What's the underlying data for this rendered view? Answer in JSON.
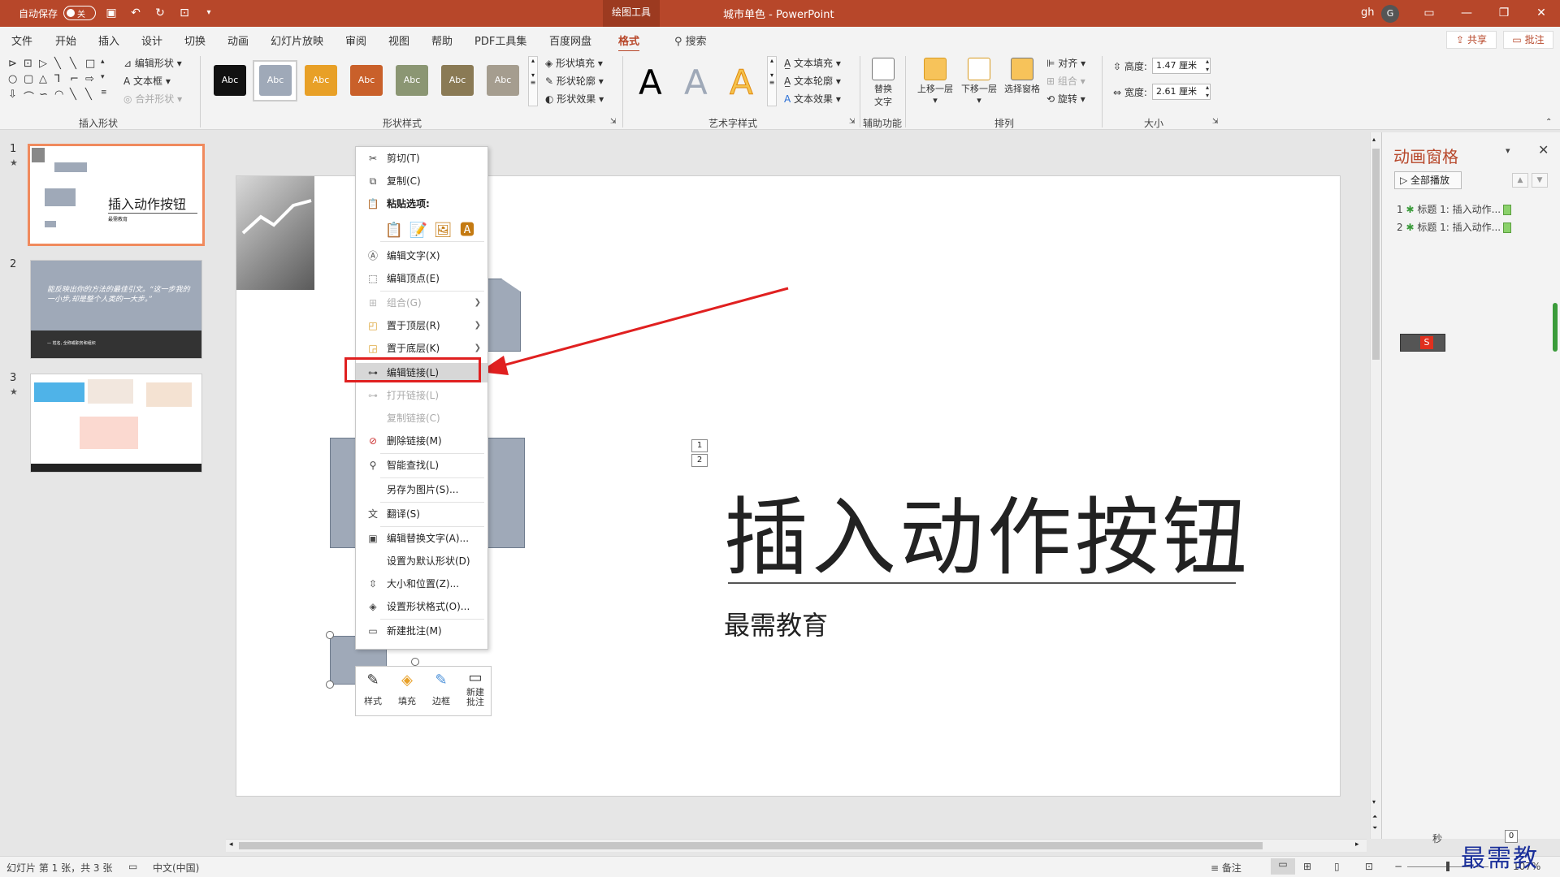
{
  "titlebar": {
    "autosave_label": "自动保存",
    "autosave_state": "关",
    "context_tab": "绘图工具",
    "doc_name": "城市单色",
    "app_name": "PowerPoint",
    "user_name": "gh",
    "user_initial": "G",
    "accent_color": "#b7472a"
  },
  "menu": {
    "tabs": [
      "文件",
      "开始",
      "插入",
      "设计",
      "切换",
      "动画",
      "幻灯片放映",
      "审阅",
      "视图",
      "帮助",
      "PDF工具集",
      "百度网盘",
      "格式"
    ],
    "active_tab": "格式",
    "search_placeholder": "搜索",
    "share_label": "共享",
    "comment_label": "批注"
  },
  "ribbon": {
    "insert_shapes": {
      "label": "插入形状",
      "edit_shape": "编辑形状",
      "text_box": "文本框",
      "merge_shapes": "合并形状"
    },
    "shape_styles": {
      "label": "形状样式",
      "swatch_text": "Abc",
      "swatches": [
        "#111111",
        "#9fa9b8",
        "#e8a027",
        "#c9602a",
        "#8b9673",
        "#8a7a55",
        "#a59d8f"
      ],
      "fill": "形状填充",
      "outline": "形状轮廓",
      "effects": "形状效果"
    },
    "wordart": {
      "label": "艺术字样式",
      "glyph": "A",
      "text_fill": "文本填充",
      "text_outline": "文本轮廓",
      "text_effects": "文本效果"
    },
    "accessibility": {
      "label": "辅助功能",
      "alt_text_line1": "替换",
      "alt_text_line2": "文字"
    },
    "arrange": {
      "label": "排列",
      "bring_forward": "上移一层",
      "send_backward": "下移一层",
      "selection_pane": "选择窗格",
      "align": "对齐",
      "group": "组合",
      "rotate": "旋转"
    },
    "size": {
      "label": "大小",
      "height_label": "高度:",
      "height_value": "1.47 厘米",
      "width_label": "宽度:",
      "width_value": "2.61 厘米"
    }
  },
  "thumbnails": {
    "slides": [
      {
        "num": "1",
        "title": "插入动作按钮",
        "subtitle": "最需教育"
      },
      {
        "num": "2",
        "quote": "能反映出你的方法的最佳引文。“这一步我的一小步,却是整个人类的一大步。”",
        "caption": "— 姓名, 全称或职务和组织"
      },
      {
        "num": "3"
      }
    ]
  },
  "slide": {
    "title": "插入动作按钮",
    "subtitle": "最需教育",
    "anim_tags": [
      "1",
      "2"
    ]
  },
  "context_menu": {
    "cut": "剪切(T)",
    "copy": "复制(C)",
    "paste_options": "粘贴选项:",
    "edit_text": "编辑文字(X)",
    "edit_points": "编辑顶点(E)",
    "group": "组合(G)",
    "bring_to_front": "置于顶层(R)",
    "send_to_back": "置于底层(K)",
    "edit_link": "编辑链接(L)",
    "open_link": "打开链接(L)",
    "copy_link": "复制链接(C)",
    "remove_link": "删除链接(M)",
    "smart_lookup": "智能查找(L)",
    "save_as_picture": "另存为图片(S)...",
    "translate": "翻译(S)",
    "edit_alt_text": "编辑替换文字(A)...",
    "set_default_shape": "设置为默认形状(D)",
    "size_position": "大小和位置(Z)...",
    "format_shape": "设置形状格式(O)...",
    "new_comment": "新建批注(M)"
  },
  "mini_toolbar": {
    "style": "样式",
    "fill": "填充",
    "outline": "边框",
    "new_comment_1": "新建",
    "new_comment_2": "批注"
  },
  "anim_pane": {
    "title": "动画窗格",
    "play_all": "全部播放",
    "items": [
      {
        "num": "1",
        "text": "标题 1: 插入动作..."
      },
      {
        "num": "2",
        "text": "标题 1: 插入动作..."
      }
    ]
  },
  "status": {
    "slide_info": "幻灯片 第 1 张，共 3 张",
    "language": "中文(中国)",
    "notes": "备注",
    "seconds": "秒",
    "zoom_box": "0",
    "zoom": "107%"
  },
  "watermark": "最需教育"
}
